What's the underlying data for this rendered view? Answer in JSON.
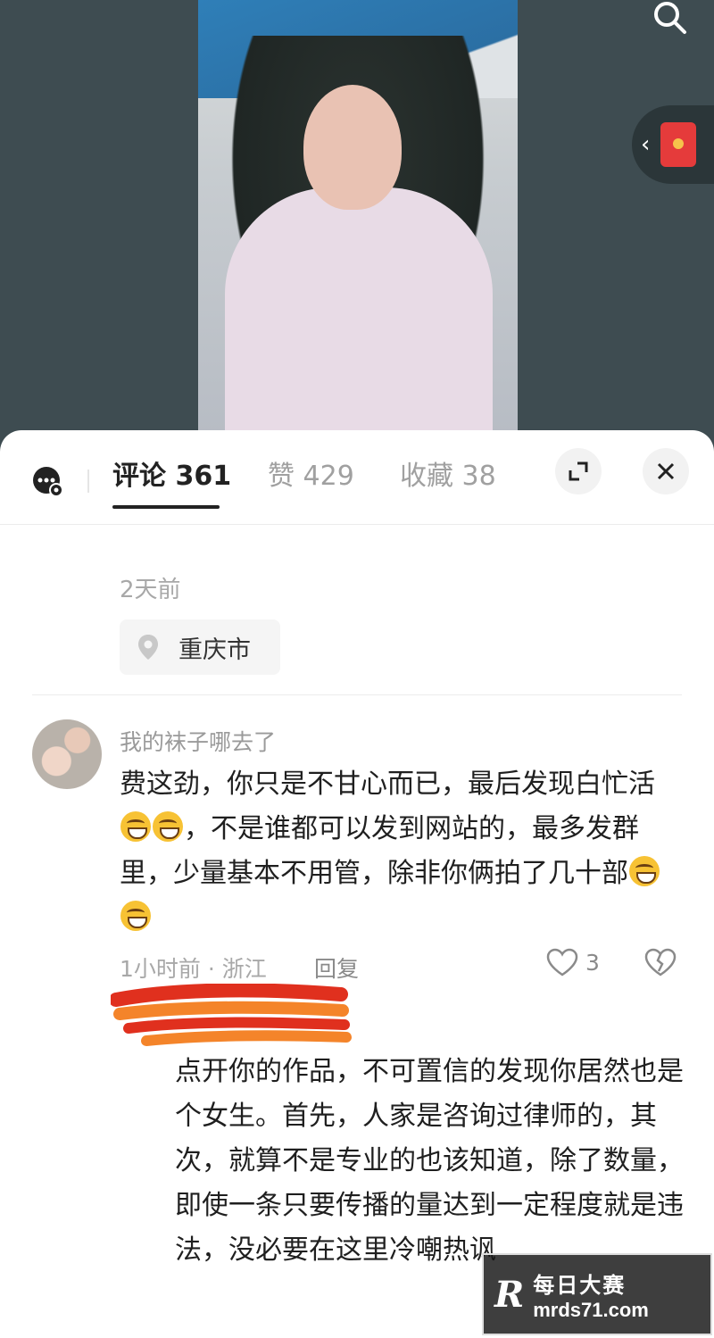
{
  "tabs": {
    "comments": "评论 361",
    "likes": "赞 429",
    "favorites": "收藏 38"
  },
  "post": {
    "time": "2天前",
    "location": "重庆市"
  },
  "comment": {
    "username": "我的袜子哪去了",
    "text_part1": "费这劲，你只是不甘心而已，最后发现白忙活",
    "text_part2": "，不是谁都可以发到网站的，最多发群里，少量基本不用管，除非你俩拍了几十部",
    "meta": "1小时前 · 浙江",
    "reply_label": "回复",
    "like_count": "3"
  },
  "reply": {
    "text": "点开你的作品，不可置信的发现你居然也是个女生。首先，人家是咨询过律师的，其次，就算不是专业的也该知道，除了数量，即使一条只要传播的量达到一定程度就是违法，没必要在这里冷嘲热讽"
  },
  "watermark": {
    "logo": "R",
    "title": "每日大赛",
    "url": "mrds71.com"
  },
  "colors": {
    "accent_red": "#e53b3b",
    "scribble_red": "#e0301e",
    "scribble_orange": "#f4842a"
  }
}
